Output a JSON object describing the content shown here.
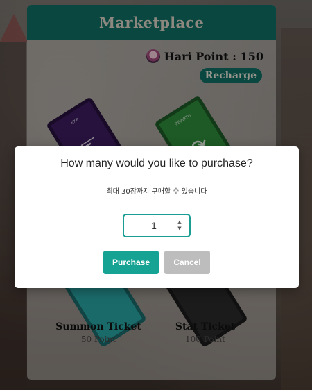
{
  "marketplace": {
    "title": "Marketplace",
    "points_label": "Hari Point : 150",
    "recharge_label": "Recharge",
    "items": [
      {
        "tag": "EXP",
        "name": "",
        "price": ""
      },
      {
        "tag": "REBIRTH",
        "name": "",
        "price": ""
      },
      {
        "tag": "",
        "name": "Summon Ticket",
        "price": "50 Point"
      },
      {
        "tag": "",
        "name": "Stat Ticket",
        "price": "100 Point"
      }
    ]
  },
  "modal": {
    "question": "How many would you like to purchase?",
    "subtitle": "최대 30장까지 구매할 수 있습니다",
    "quantity": "1",
    "purchase_label": "Purchase",
    "cancel_label": "Cancel"
  },
  "icons": {
    "avatar": "user-avatar-icon",
    "spin_up": "▲",
    "spin_down": "▼"
  },
  "colors": {
    "brand_teal": "#0f6e63",
    "purchase_button": "#16a394",
    "cancel_button": "#bdbdbd",
    "input_border": "#1a9e93"
  }
}
